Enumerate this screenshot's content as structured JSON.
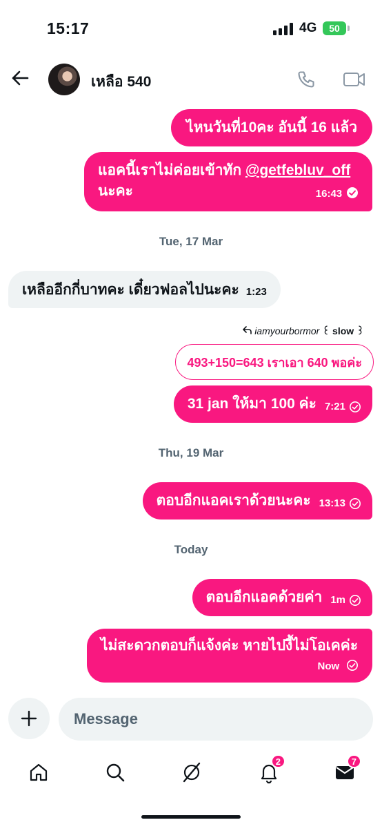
{
  "status_bar": {
    "time": "15:17",
    "network": "4G",
    "battery": "50"
  },
  "header": {
    "contact_name": "เหลือ 540"
  },
  "messages": [
    {
      "text": "ไหนวันที่10คะ อันนี้ 16 แล้ว"
    },
    {
      "text": "แอคนี้เราไม่ค่อยเข้าทัก",
      "mention": "@getfebluv_off",
      "text_after": "นะคะ",
      "time": "16:43"
    },
    {
      "date": "Tue, 17 Mar"
    },
    {
      "text": "เหลืออีกกี่บาทคะ เดี๋ยวฟอลไปนะคะ",
      "time": "1:23"
    },
    {
      "reply_to": "iamyourbormor",
      "reply_to_name": "꒰ slow ꒱",
      "quoted": "493+150=643 เราเอา 640 พอค่ะ",
      "text": "31 jan ให้มา 100 ค่ะ",
      "time": "7:21"
    },
    {
      "date": "Thu, 19 Mar"
    },
    {
      "text": "ตอบอีกแอคเราด้วยนะคะ",
      "time": "13:13"
    },
    {
      "date": "Today"
    },
    {
      "text": "ตอบอีกแอคด้วยค่า",
      "time": "1m"
    },
    {
      "text": "ไม่สะดวกตอบก็แจ้งค่ะ หายไปงี้ไม่โอเคค่ะ",
      "time": "Now"
    }
  ],
  "composer": {
    "placeholder": "Message"
  },
  "tabs": {
    "notifications_badge": "2",
    "messages_badge": "7"
  },
  "colors": {
    "accent": "#f91880",
    "incoming_bg": "#eff3f4",
    "muted_text": "#536471"
  }
}
